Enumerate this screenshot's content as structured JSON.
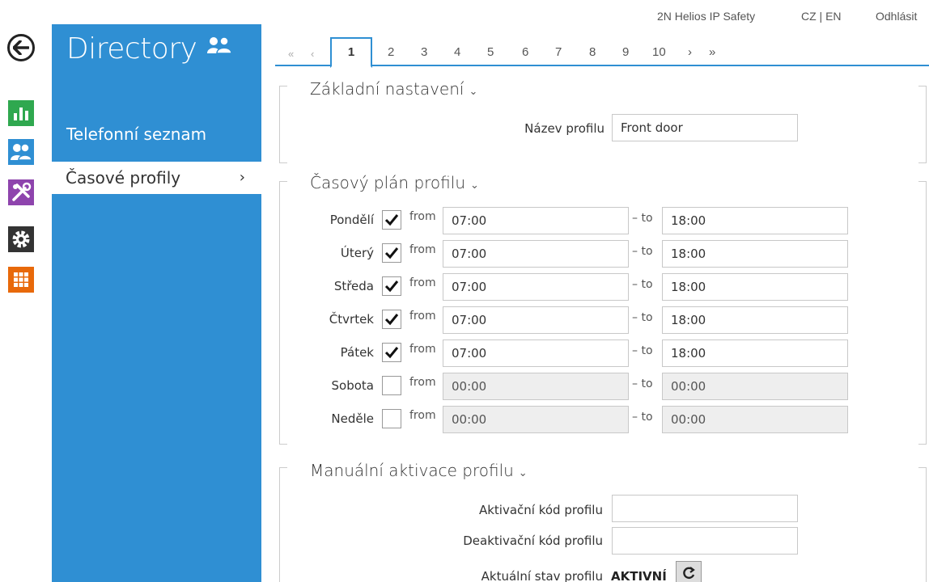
{
  "header": {
    "device_name": "2N Helios IP Safety",
    "lang": "CZ | EN",
    "logout": "Odhlásit"
  },
  "rail": {
    "icons": [
      "back-icon",
      "dashboard-icon",
      "directory-icon",
      "services-icon",
      "settings-icon",
      "system-icon"
    ],
    "colors": {
      "dashboard": "#2fa84f",
      "directory": "#2f8fd3",
      "services": "#8e44ad",
      "settings": "#333333",
      "system": "#e8690a"
    }
  },
  "sidebar": {
    "title": "Directory",
    "title_icon": "users-icon",
    "items": [
      {
        "label": "Telefonní seznam",
        "active": false
      },
      {
        "label": "Časové profily",
        "active": true,
        "chevron": "›"
      }
    ]
  },
  "pager": {
    "first": "«",
    "prev": "‹",
    "pages": [
      "1",
      "2",
      "3",
      "4",
      "5",
      "6",
      "7",
      "8",
      "9",
      "10"
    ],
    "current": "1",
    "next": "›",
    "last": "»"
  },
  "basic": {
    "title": "Základní nastavení",
    "name_label": "Název profilu",
    "name_value": "Front door"
  },
  "schedule": {
    "title": "Časový plán profilu",
    "from_label": "from",
    "to_label": "– to",
    "days": [
      {
        "day": "Pondělí",
        "checked": true,
        "from": "07:00",
        "to": "18:00"
      },
      {
        "day": "Úterý",
        "checked": true,
        "from": "07:00",
        "to": "18:00"
      },
      {
        "day": "Středa",
        "checked": true,
        "from": "07:00",
        "to": "18:00"
      },
      {
        "day": "Čtvrtek",
        "checked": true,
        "from": "07:00",
        "to": "18:00"
      },
      {
        "day": "Pátek",
        "checked": true,
        "from": "07:00",
        "to": "18:00"
      },
      {
        "day": "Sobota",
        "checked": false,
        "from": "00:00",
        "to": "00:00"
      },
      {
        "day": "Neděle",
        "checked": false,
        "from": "00:00",
        "to": "00:00"
      }
    ]
  },
  "manual": {
    "title": "Manuální aktivace profilu",
    "activation_label": "Aktivační kód profilu",
    "activation_value": "",
    "deactivation_label": "Deaktivační kód profilu",
    "deactivation_value": "",
    "status_label": "Aktuální stav profilu",
    "status_value": "AKTIVNÍ"
  }
}
